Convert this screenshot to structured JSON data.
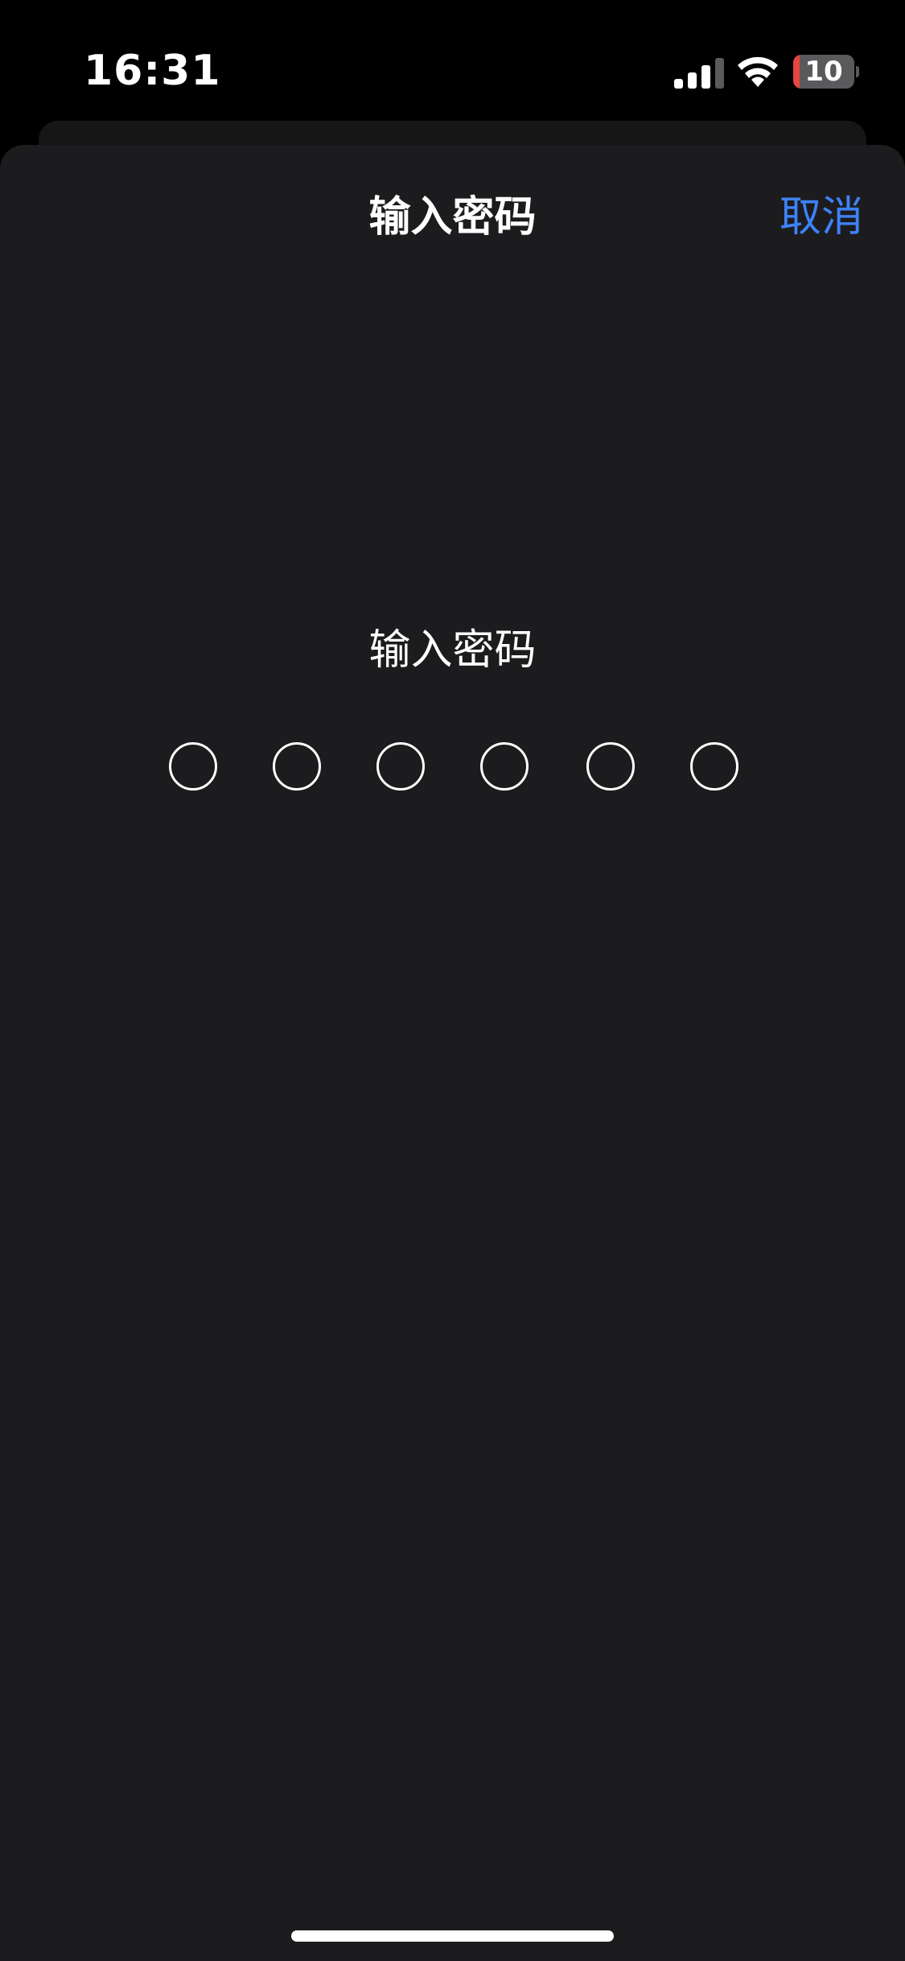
{
  "status_bar": {
    "time": "16:31",
    "battery_level": "10",
    "battery_fraction": 0.1,
    "icons": [
      "signal-icon",
      "wifi-icon",
      "battery-icon"
    ]
  },
  "nav": {
    "title": "输入密码",
    "cancel_label": "取消"
  },
  "passcode": {
    "prompt": "输入密码",
    "digits_total": 6,
    "digits_entered": 0
  },
  "colors": {
    "background": "#000000",
    "sheet": "#1c1c1e",
    "accent": "#3e82f7",
    "battery_low": "#e5463e"
  }
}
